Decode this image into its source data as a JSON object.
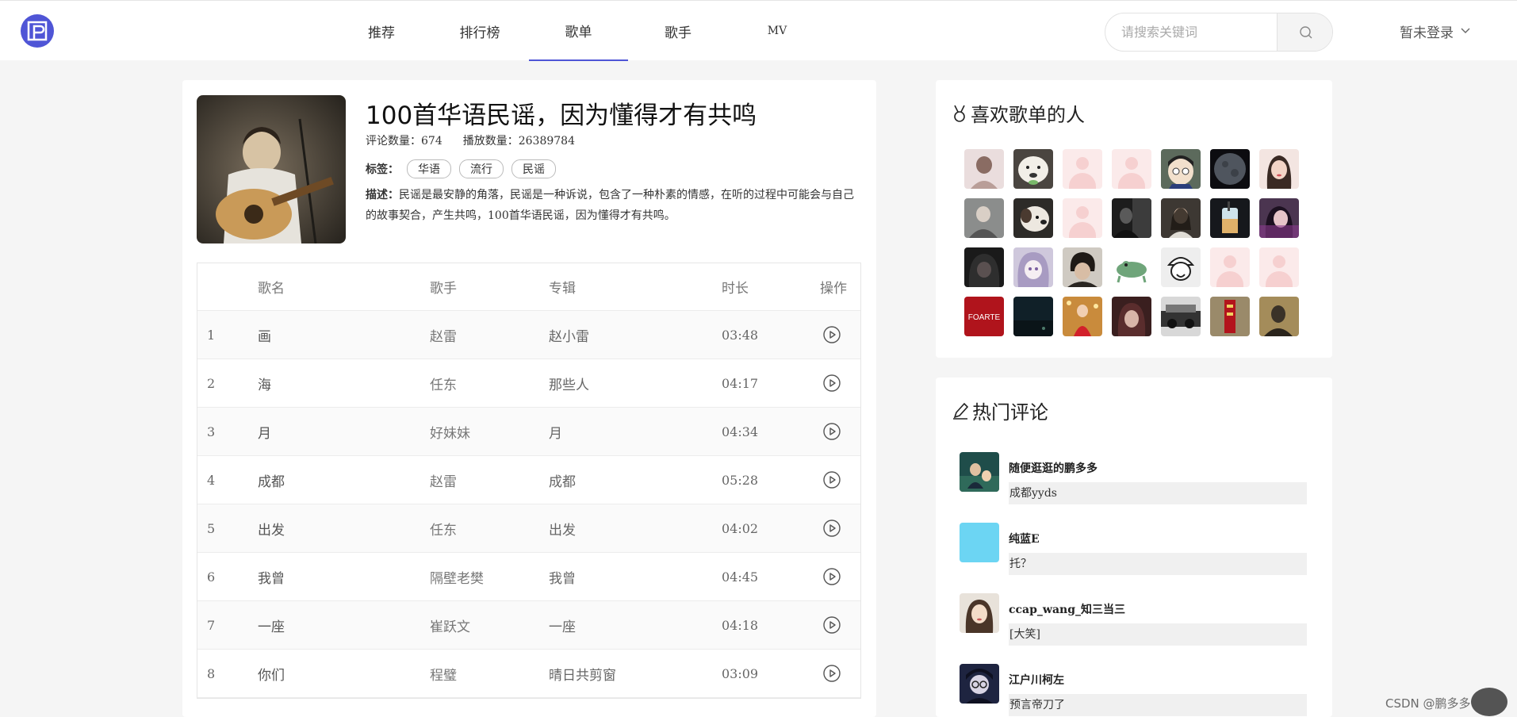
{
  "header": {
    "logo_icon": "logo-icon",
    "nav": [
      {
        "label": "推荐"
      },
      {
        "label": "排行榜"
      },
      {
        "label": "歌单"
      },
      {
        "label": "歌手"
      },
      {
        "label": "MV"
      }
    ],
    "active_nav": "歌单",
    "search_placeholder": "请搜索关键词",
    "search_icon": "search-icon",
    "login_label": "暂未登录",
    "accent_color": "#4f55d6"
  },
  "playlist": {
    "title": "100首华语民谣，因为懂得才有共鸣",
    "comment_label": "评论数量：",
    "comment_count": "674",
    "play_label": "播放数量：",
    "play_count": "26389784",
    "tags_label": "标签：",
    "tags": [
      "华语",
      "流行",
      "民谣"
    ],
    "desc_label": "描述：",
    "desc": "民谣是最安静的角落，民谣是一种诉说，包含了一种朴素的情感，在听的过程中可能会与自己的故事契合，产生共鸣，100首华语民谣，因为懂得才有共鸣。"
  },
  "table": {
    "headers": {
      "name": "歌名",
      "artist": "歌手",
      "album": "专辑",
      "duration": "时长",
      "op": "操作"
    },
    "rows": [
      {
        "idx": "1",
        "name": "画",
        "artist": "赵雷",
        "album": "赵小雷",
        "duration": "03:48"
      },
      {
        "idx": "2",
        "name": "海",
        "artist": "任东",
        "album": "那些人",
        "duration": "04:17"
      },
      {
        "idx": "3",
        "name": "月",
        "artist": "好妹妹",
        "album": "月",
        "duration": "04:34"
      },
      {
        "idx": "4",
        "name": "成都",
        "artist": "赵雷",
        "album": "成都",
        "duration": "05:28"
      },
      {
        "idx": "5",
        "name": "出发",
        "artist": "任东",
        "album": "出发",
        "duration": "04:02"
      },
      {
        "idx": "6",
        "name": "我曾",
        "artist": "隔壁老樊",
        "album": "我曾",
        "duration": "04:45"
      },
      {
        "idx": "7",
        "name": "一座",
        "artist": "崔跃文",
        "album": "一座",
        "duration": "04:18"
      },
      {
        "idx": "8",
        "name": "你们",
        "artist": "程璧",
        "album": "晴日共剪窗",
        "duration": "03:09"
      }
    ]
  },
  "likers": {
    "title": "喜欢歌单的人",
    "avatar_texts": {
      "foarte": "FOARTE"
    }
  },
  "comments": {
    "title": "热门评论",
    "items": [
      {
        "user": "随便逛逛的鹏多多",
        "text": "成都yyds"
      },
      {
        "user": "纯蓝E",
        "text": "托？"
      },
      {
        "user": "ccap_wang_知三当三",
        "text": "[大笑]"
      },
      {
        "user": "江户川柯左",
        "text": "预言帝刀了"
      }
    ]
  },
  "watermark": "CSDN @鹏多多"
}
